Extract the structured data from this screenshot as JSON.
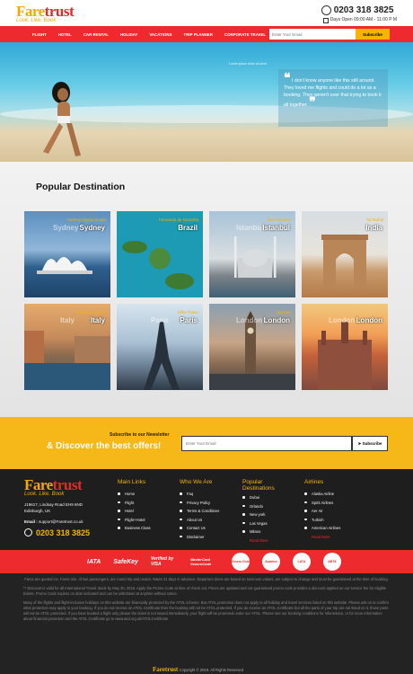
{
  "brand": {
    "name_a": "Fare",
    "name_b": "trust",
    "tagline": "Look. Like. Book"
  },
  "contact": {
    "phone": "0203 318 3825",
    "hours": "Days Open 09:00 AM - 11:00 P M"
  },
  "nav": {
    "items": [
      "FLIGHT",
      "HOTEL",
      "CAR RENTAL",
      "HOLIDAY",
      "VACATIONS",
      "TRIP PLANNER",
      "CORPORATE TRAVEL"
    ]
  },
  "newsletter_top": {
    "placeholder": "Enter Your Email",
    "button": "Subscribe"
  },
  "hero": {
    "caption": "Lorem ipsum dolor sit amet",
    "quote": "I don't know anyone like this still around. They loved me flights and could do a lot as a booking. They weren't ever that trying to book it all together."
  },
  "popular": {
    "title": "Popular Destination",
    "cards": [
      {
        "tag": "Sydney Opera House",
        "ghost": "Sydney",
        "city": "Sydney"
      },
      {
        "tag": "Fernando de Noronha",
        "ghost": "",
        "city": "Brazil"
      },
      {
        "tag": "Blue Mosque",
        "ghost": "Istanbul",
        "city": "Istanbul"
      },
      {
        "tag": "Taj Mahal",
        "ghost": "",
        "city": "India"
      },
      {
        "tag": "Grand of Venice",
        "ghost": "Italy",
        "city": "Italy"
      },
      {
        "tag": "Eiffel Tower",
        "ghost": "Paris",
        "city": "Paris"
      },
      {
        "tag": "Big Ben",
        "ghost": "London",
        "city": "London"
      },
      {
        "tag": "",
        "ghost": "London",
        "city": "London"
      }
    ]
  },
  "newsletter": {
    "sub": "Subscribe to our Newsletter",
    "headline": "& Discover the best offers!",
    "placeholder": "Enter Your Email",
    "button": "Subscribe"
  },
  "footer": {
    "address": [
      "J19617, Lindsay Road EH9 6ND",
      "Edinburgh, UK"
    ],
    "email_label": "Email :",
    "email": "support@Faretrust.co.uk",
    "phone": "0203 318 3825",
    "cols": [
      {
        "title": "Main Links",
        "items": [
          "Home",
          "Flight",
          "Hotel",
          "Flight+Hotel",
          "Business Class"
        ],
        "more": ""
      },
      {
        "title": "Who We Are",
        "items": [
          "Faq",
          "Privacy Policy",
          "Terms & Conditions",
          "About Us",
          "Contact Us",
          "Disclaimer"
        ],
        "more": ""
      },
      {
        "title": "Popular Destinations",
        "items": [
          "Dubai",
          "Orlando",
          "New york",
          "Las Vegas",
          "Milano"
        ],
        "more": "Read More"
      },
      {
        "title": "Airlines",
        "items": [
          "Alaska Airline",
          "Spirit Airlines",
          "Aer Air",
          "Turkish",
          "American Airlines"
        ],
        "more": "Read More"
      }
    ]
  },
  "partners": [
    "IATA",
    "SafeKey",
    "Verified by VISA",
    "MasterCard SecureCode",
    "Diners Club",
    "Aviation",
    "LATA",
    "ABTA"
  ],
  "legal": {
    "p1": "Fares are quoted inc. Fares min. of two passengers, are round trip and routes. Rates 21 days in advance. Departure times are based on minimum values, are subject to change and must be guaranteed at the time of booking.",
    "p2": "** Discount is valid for all International Travel. Book by May 30, 2018. Apply the Promo Code at time of check out. Prices are updated and not guaranteed promo code provides a discount applied on our service fee for eligible tickets. Promo Code expires on date indicated and can be withdrawn at anytime without notice.",
    "p3": "Many of the flights and flight-inclusive holidays on this website are financially protected by the ATOL scheme. But ATOL protection does not apply to all holiday and travel services listed on this website. Please ask us to confirm what protection may apply to your booking. If you do not receive an ATOL Certificate then the booking will not be ATOL protected. If you do receive an ATOL Certificate but all the parts of your trip are not listed on it, those parts will not be ATOL protected. If you have booked a flight only please the ticket is not issued immediately, your flight will be protected under our ATOL. Please see our booking conditions for information, or for more information about financial protection and the ATOL Certificate go to www.atol.org.uk/ATOLCertificate",
    "copy": "Copyright © 2018. All Rights Reserved"
  }
}
